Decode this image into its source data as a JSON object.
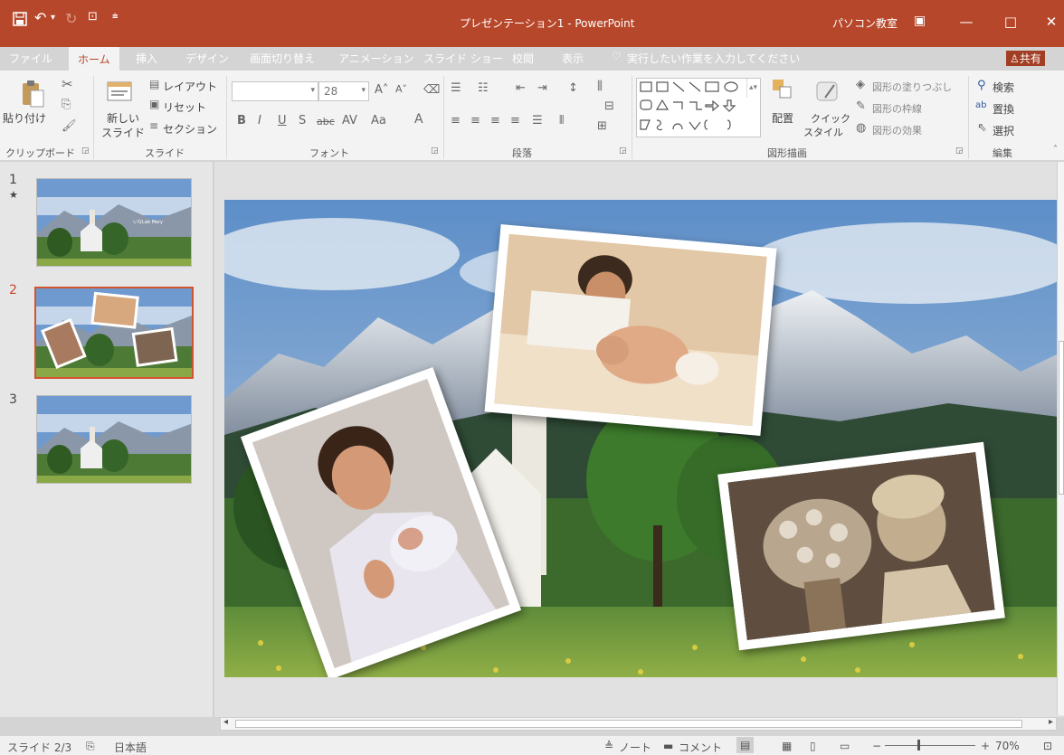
{
  "window": {
    "title": "プレゼンテーション1 - PowerPoint",
    "user": "パソコン教室",
    "minimize": "—",
    "maximize": "□",
    "close": "✕"
  },
  "tabs": [
    "ファイル",
    "ホーム",
    "挿入",
    "デザイン",
    "画面切り替え",
    "アニメーション",
    "スライド ショー",
    "校閲",
    "表示"
  ],
  "tell_me": "実行したい作業を入力してください",
  "share": "共有",
  "ribbon": {
    "clipboard": {
      "paste": "貼り付け",
      "label": "クリップボード"
    },
    "slides": {
      "new_slide_1": "新しい",
      "new_slide_2": "スライド",
      "layout": "レイアウト",
      "reset": "リセット",
      "section": "セクション",
      "label": "スライド"
    },
    "font": {
      "font_name": "",
      "font_size": "28",
      "label": "フォント",
      "bold": "B",
      "italic": "I",
      "underline": "U",
      "shadow": "S",
      "strike": "abc",
      "aa": "Aa"
    },
    "paragraph": {
      "label": "段落"
    },
    "drawing": {
      "arrange": "配置",
      "quick_style_1": "クイック",
      "quick_style_2": "スタイル",
      "fill": "図形の塗りつぶし",
      "outline": "図形の枠線",
      "effects": "図形の効果",
      "label": "図形描画"
    },
    "editing": {
      "find": "検索",
      "replace": "置換",
      "select": "選択",
      "label": "編集"
    }
  },
  "thumbnails": [
    {
      "num": "1",
      "star": "★",
      "caption": "いなLab Mary"
    },
    {
      "num": "2"
    },
    {
      "num": "3"
    }
  ],
  "status": {
    "slide": "スライド 2/3",
    "language": "日本語",
    "notes": "ノート",
    "comments": "コメント",
    "zoom": "70%"
  },
  "colors": {
    "accent": "#b7472a"
  }
}
